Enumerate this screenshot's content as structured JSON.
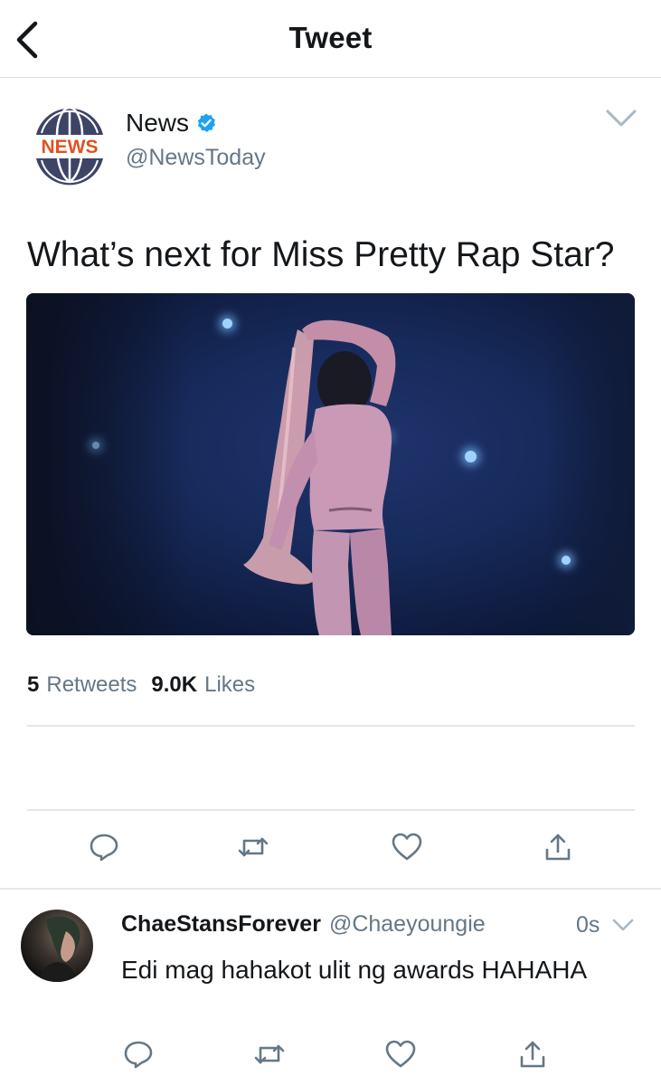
{
  "nav": {
    "title": "Tweet"
  },
  "tweet": {
    "author_name": "News",
    "author_handle": "@NewsToday",
    "avatar_label": "NEWS",
    "text": "What’s next for Miss Pretty Rap Star?",
    "retweets_count": "5",
    "retweets_label": "Retweets",
    "likes_count": "9.0K",
    "likes_label": "Likes"
  },
  "reply": {
    "author_name": "ChaeStansForever",
    "author_handle": "@Chaeyoungie",
    "time": "0s",
    "text": "Edi mag hahakot ulit ng awards HAHAHA"
  },
  "icons": {
    "back": "chevron-left-icon",
    "verified": "verified-badge-icon",
    "menu": "chevron-down-icon",
    "reply": "reply-icon",
    "retweet": "retweet-icon",
    "like": "heart-icon",
    "share": "share-icon"
  },
  "colors": {
    "text": "#14171a",
    "secondary": "#657786",
    "verified": "#1da1f2",
    "divider": "#e1e8ed",
    "news_logo_dark": "#3d4466",
    "news_logo_accent": "#e0521f"
  }
}
